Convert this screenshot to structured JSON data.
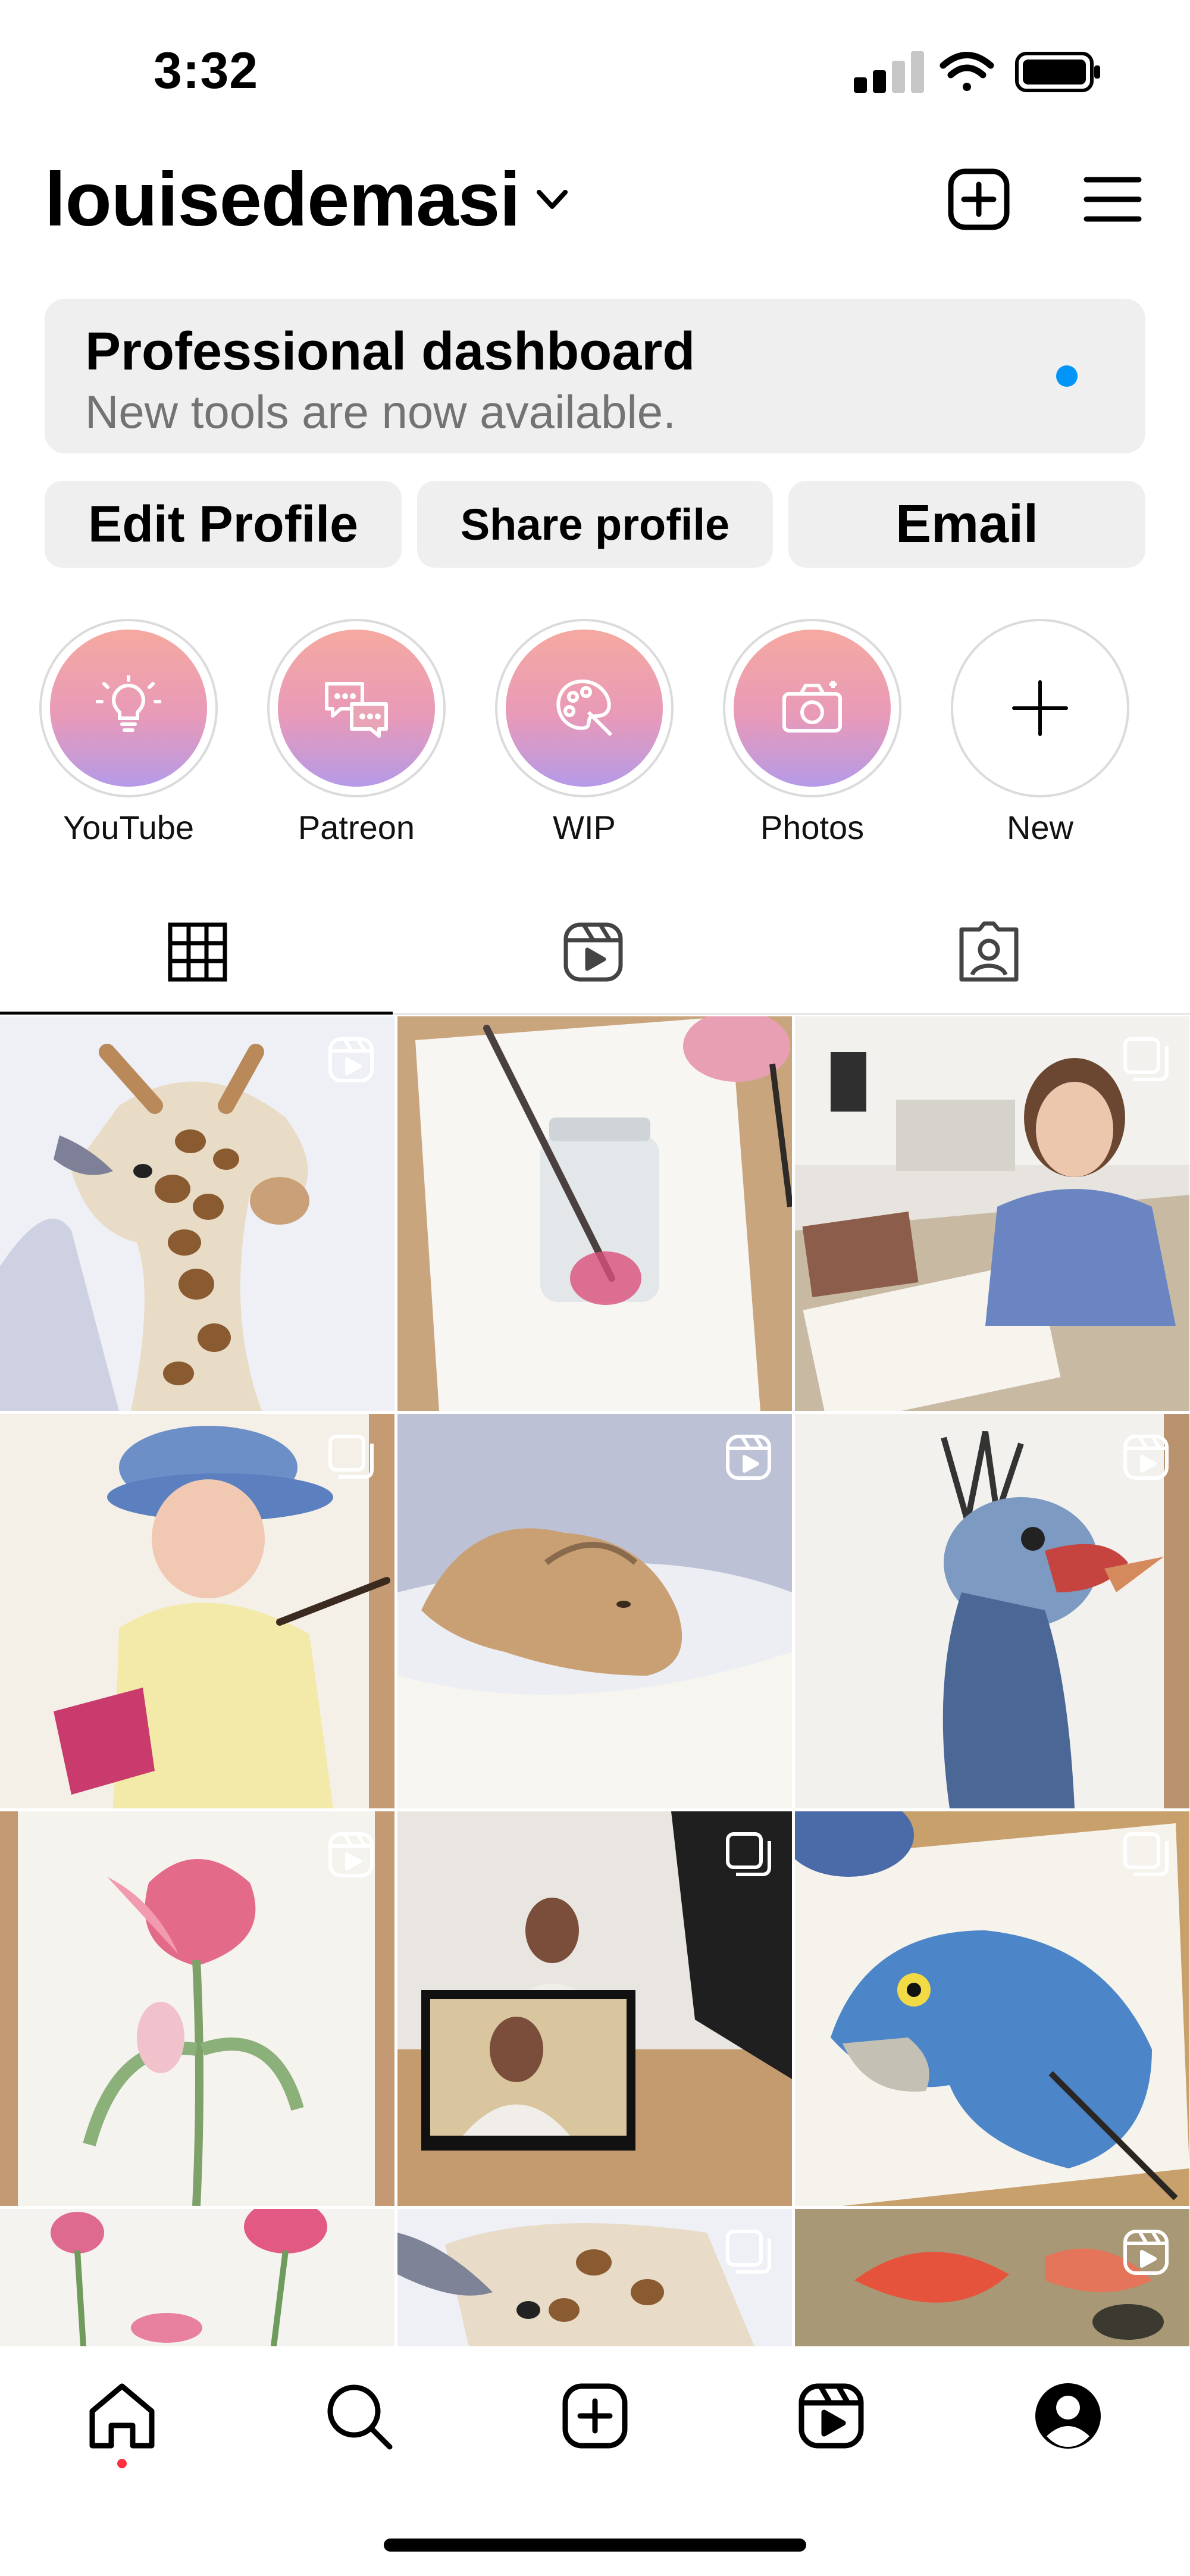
{
  "status_bar": {
    "time": "3:32",
    "icons": [
      "signal-icon",
      "wifi-icon",
      "battery-icon"
    ]
  },
  "header": {
    "username": "louisedemasi",
    "icons": [
      "chevron-down-icon",
      "new-post-icon",
      "menu-icon"
    ]
  },
  "dashboard": {
    "title": "Professional dashboard",
    "subtitle": "New tools are now available.",
    "dot_color": "#0095f6"
  },
  "buttons": {
    "edit": "Edit Profile",
    "share": "Share profile",
    "email": "Email"
  },
  "highlights": [
    {
      "label": "YouTube",
      "icon": "lightbulb-icon"
    },
    {
      "label": "Patreon",
      "icon": "chat-bubbles-icon"
    },
    {
      "label": "WIP",
      "icon": "palette-icon"
    },
    {
      "label": "Photos",
      "icon": "camera-icon"
    },
    {
      "label": "New",
      "icon": "plus-icon"
    }
  ],
  "tabs": [
    "grid-icon",
    "reels-icon",
    "tagged-icon"
  ],
  "grid": [
    {
      "subject": "giraffe painting",
      "badge": "reel"
    },
    {
      "subject": "jar with brush painting",
      "badge": "none"
    },
    {
      "subject": "artist at desk",
      "badge": "multi"
    },
    {
      "subject": "child in hat painting",
      "badge": "multi"
    },
    {
      "subject": "lioness painting",
      "badge": "reel"
    },
    {
      "subject": "guinea fowl painting",
      "badge": "reel"
    },
    {
      "subject": "tulip painting",
      "badge": "reel"
    },
    {
      "subject": "studio video",
      "badge": "multi"
    },
    {
      "subject": "blue parrot painting",
      "badge": "multi"
    },
    {
      "subject": "pink tulips",
      "badge": "none"
    },
    {
      "subject": "giraffe close-up",
      "badge": "multi"
    },
    {
      "subject": "fish painting",
      "badge": "reel"
    }
  ],
  "bottom_nav": [
    "home-icon",
    "search-icon",
    "create-icon",
    "reels-icon",
    "profile-icon"
  ],
  "colors": {
    "accent": "#0095f6",
    "notification": "#ff3040",
    "button_bg": "#efefef"
  }
}
